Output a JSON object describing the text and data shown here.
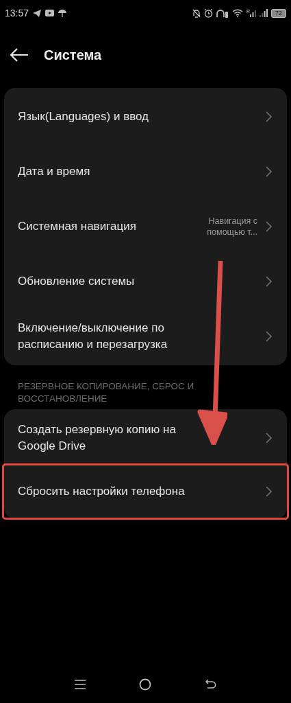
{
  "status_bar": {
    "time": "13:57",
    "roaming": "R",
    "battery": "72"
  },
  "header": {
    "title": "Система"
  },
  "groups": [
    {
      "items": [
        {
          "label": "Язык(Languages) и ввод",
          "highlighted": false
        },
        {
          "label": "Дата и время",
          "highlighted": false
        },
        {
          "label": "Системная навигация",
          "value": "Навигация с помощью т...",
          "highlighted": false
        },
        {
          "label": "Обновление системы",
          "highlighted": false
        },
        {
          "label": "Включение/выключение по расписанию и перезагрузка",
          "highlighted": false
        }
      ]
    },
    {
      "heading": "РЕЗЕРВНОЕ КОПИРОВАНИЕ, СБРОС И ВОССТАНОВЛЕНИЕ",
      "items": [
        {
          "label": "Создать резервную копию на Google Drive",
          "highlighted": false
        },
        {
          "label": "Сбросить настройки телефона",
          "highlighted": true
        }
      ]
    }
  ]
}
